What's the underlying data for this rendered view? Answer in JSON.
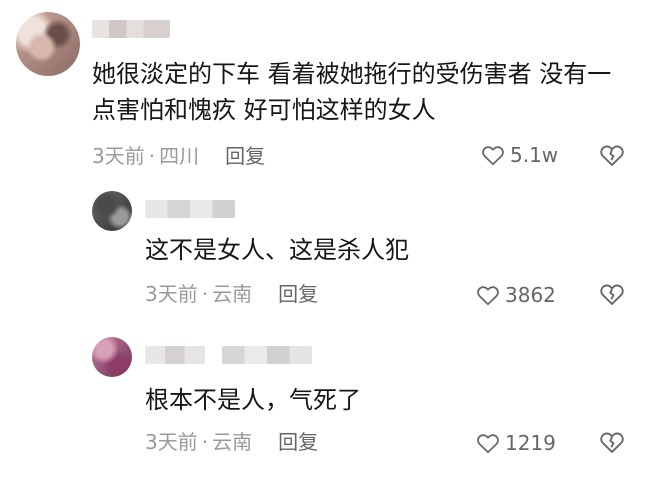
{
  "comments": [
    {
      "id": "main",
      "text": "她很淡定的下车 看着被她拖行的受伤害者 没有一点害怕和愧疚 好可怕这样的女人",
      "time": "3天前",
      "location": "四川",
      "reply_label": "回复",
      "like_count": "5.1w"
    }
  ],
  "replies": [
    {
      "text": "这不是女人、这是杀人犯",
      "time": "3天前",
      "location": "云南",
      "reply_label": "回复",
      "like_count": "3862"
    },
    {
      "text": "根本不是人，气死了",
      "time": "3天前",
      "location": "云南",
      "reply_label": "回复",
      "like_count": "1219"
    }
  ],
  "meta_separator": "·",
  "icons": {
    "like": "heart-outline-icon",
    "dislike": "broken-heart-icon"
  },
  "colors": {
    "text": "#161616",
    "meta": "#9a9a9a",
    "action": "#666666"
  }
}
